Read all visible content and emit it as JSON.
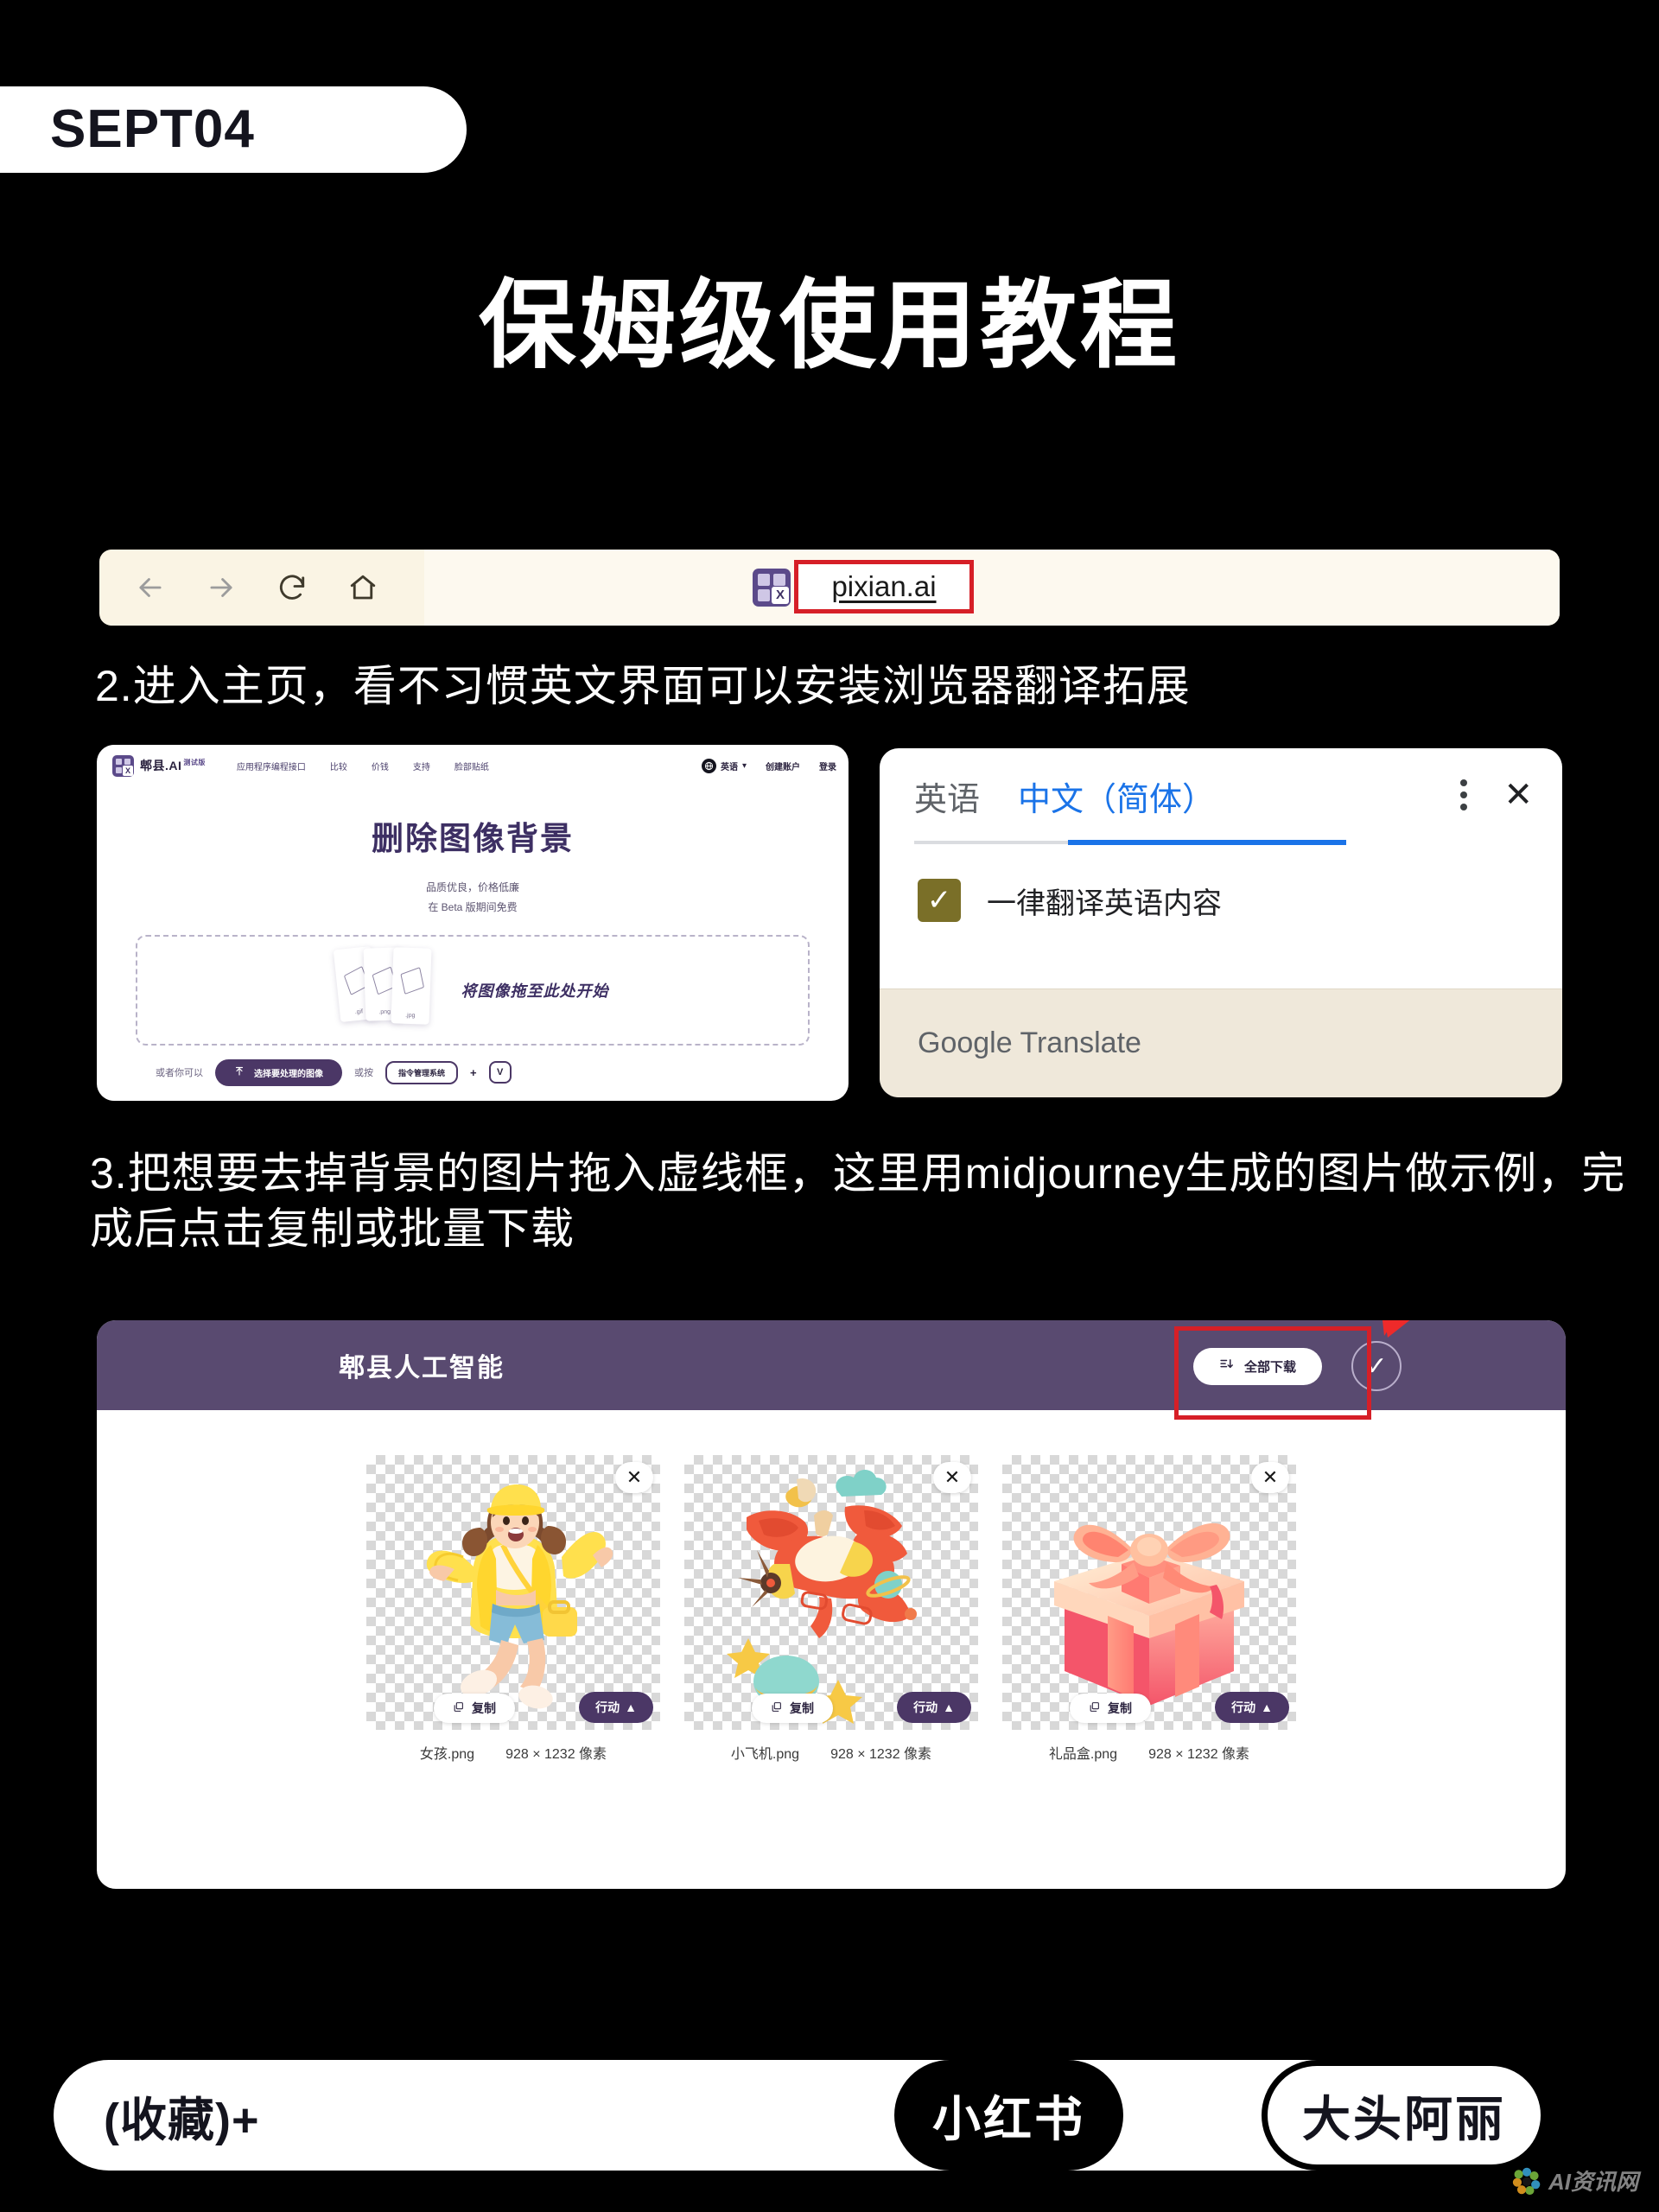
{
  "poster": {
    "date_badge": "SEPT04",
    "title": "保姆级使用教程"
  },
  "browser": {
    "back_icon": "arrow-left-icon",
    "forward_icon": "arrow-right-icon",
    "reload_icon": "reload-icon",
    "home_icon": "home-icon",
    "favicon_letter": "X",
    "url": "pixian.ai",
    "highlight_color": "#d61f27"
  },
  "steps": {
    "step2": "2.进入主页，看不习惯英文界面可以安装浏览器翻译拓展",
    "step3": "3.把想要去掉背景的图片拖入虚线框，这里用midjourney生成的图片做示例，完成后点击复制或批量下载"
  },
  "pixian_site": {
    "logo_text": "郫县.AI",
    "logo_sup": "测试版",
    "nav_items": [
      "应用程序编程接口",
      "比较",
      "价钱",
      "支持",
      "脸部贴纸"
    ],
    "language": "英语",
    "language_caret": "▾",
    "create_account": "创建账户",
    "sign_in": "登录",
    "heading": "删除图像背景",
    "sub1": "品质优良，价格低廉",
    "sub2": "在 Beta 版期间免费",
    "drop_text": "将图像拖至此处开始",
    "file_types": [
      ".gif",
      ".png",
      ".jpg"
    ],
    "or_you_can": "或者你可以",
    "select_button": "选择要处理的图像",
    "select_button_icon": "upload-icon",
    "or_press": "或按",
    "shortcut_key": "指令管理系统",
    "plus": "+",
    "shortcut_letter": "V"
  },
  "google_translate": {
    "tab_source": "英语",
    "tab_target": "中文（简体）",
    "active_tab": "中文（简体）",
    "menu_icon": "kebab-menu-icon",
    "close_icon": "close-icon",
    "checkbox_checked": true,
    "checkbox_glyph": "✓",
    "checkbox_label": "一律翻译英语内容",
    "brand": "Google Translate",
    "accent_color": "#1a73e8",
    "checkbox_color": "#7a6f28"
  },
  "result_panel": {
    "title": "郫县人工智能",
    "download_all_label": "全部下载",
    "download_all_icon": "download-all-icon",
    "select_all_icon": "check-circle-icon",
    "select_all_glyph": "✓",
    "header_color": "#594a70",
    "annotation_arrow": "red-arrow-icon",
    "cards": [
      {
        "art": "girl",
        "close_icon": "close-icon",
        "close_glyph": "✕",
        "copy_label": "复制",
        "copy_icon": "copy-icon",
        "action_label": "行动",
        "action_caret": "▲",
        "filename": "女孩.png",
        "dimensions": "928 × 1232 像素"
      },
      {
        "art": "plane",
        "close_icon": "close-icon",
        "close_glyph": "✕",
        "copy_label": "复制",
        "copy_icon": "copy-icon",
        "action_label": "行动",
        "action_caret": "▲",
        "filename": "小飞机.png",
        "dimensions": "928 × 1232 像素"
      },
      {
        "art": "giftbox",
        "close_icon": "close-icon",
        "close_glyph": "✕",
        "copy_label": "复制",
        "copy_icon": "copy-icon",
        "action_label": "行动",
        "action_caret": "▲",
        "filename": "礼品盒.png",
        "dimensions": "928 × 1232 像素"
      }
    ]
  },
  "footer": {
    "favorite_label": "(收藏)+",
    "platform_badge": "小红书",
    "author_badge": "大头阿丽",
    "watermark_text": "AI资讯网",
    "watermark_icon": "flower-logo-icon"
  }
}
